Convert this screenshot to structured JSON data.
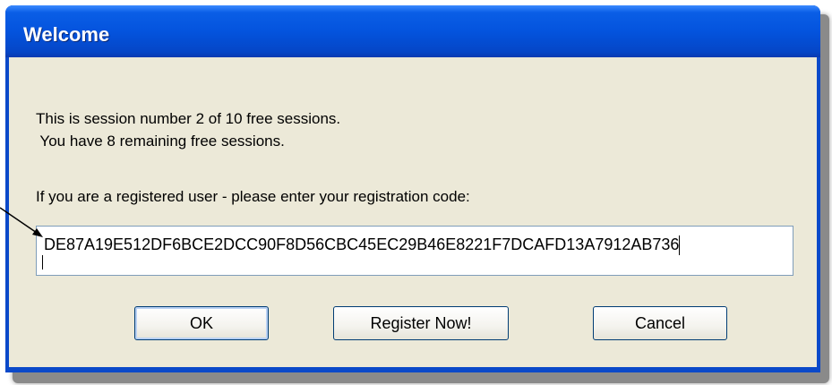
{
  "window": {
    "title": "Welcome"
  },
  "message": {
    "line1": "This is session number 2 of 10 free sessions.",
    "line2": " You have 8 remaining free sessions.",
    "prompt": "If you are a registered user - please enter your registration code:"
  },
  "registration": {
    "value": "DE87A19E512DF6BCE2DCC90F8D56CBC45EC29B46E8221F7DCAFD13A7912AB736"
  },
  "buttons": {
    "ok": "OK",
    "register": "Register Now!",
    "cancel": "Cancel"
  },
  "colors": {
    "titlebar": "#0453dd",
    "dialog_bg": "#ece9d8",
    "button_border": "#003c74"
  }
}
